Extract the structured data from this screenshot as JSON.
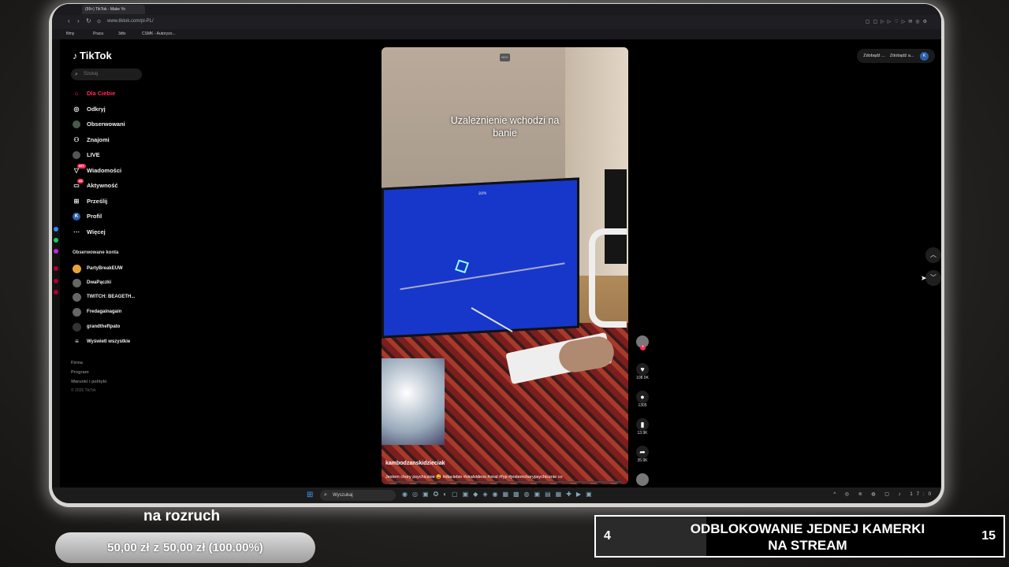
{
  "browser": {
    "tab_title": "(99+) TikTok - Make Yo",
    "url": "www.tiktok.com/pl-PL/",
    "bookmarks": [
      "filmy",
      "Praca",
      "3dtv",
      "CSMK - Autoryzo..."
    ]
  },
  "tiktok": {
    "logo": "TikTok",
    "search_placeholder": "Szukaj",
    "menu": [
      {
        "label": "Dla Ciebie",
        "icon": "home-icon",
        "active": true
      },
      {
        "label": "Odkryj",
        "icon": "compass-icon"
      },
      {
        "label": "Obserwowani",
        "icon": "following-icon"
      },
      {
        "label": "Znajomi",
        "icon": "friends-icon"
      },
      {
        "label": "LIVE",
        "icon": "live-icon"
      },
      {
        "label": "Wiadomości",
        "icon": "messages-icon",
        "badge": "99+"
      },
      {
        "label": "Aktywność",
        "icon": "activity-icon",
        "badge": "43"
      },
      {
        "label": "Prześlij",
        "icon": "upload-icon"
      },
      {
        "label": "Profil",
        "icon": "profile-icon",
        "avatar_letter": "K"
      },
      {
        "label": "Więcej",
        "icon": "more-icon"
      }
    ],
    "followed_title": "Obserwowane konta",
    "followed_accounts": [
      "PartyBreakEUW",
      "DwaPączki",
      "TWITCH: BEAGETH...",
      "Fredagainagain",
      "grandtheftpato",
      "Wyświetl wszystkie"
    ],
    "footer_links": [
      "Firma",
      "Program",
      "Warunki i polityki"
    ],
    "copyright": "© 2026 TikTok",
    "top_right": {
      "item1": "Zdobądź ...",
      "item2": "Zdobądź a...",
      "avatar": "K"
    }
  },
  "video": {
    "top_chip": "BGX",
    "caption_line1": "Uzależnienie wchodzi na",
    "caption_line2": "banie",
    "tv_text": "31%",
    "username": "kambodzanskidzieciak",
    "description": "Jestem chory psychicznie 😩 #dlaciebie #viralvideos #viral #fyp #jestemchorypsychicznie co",
    "likes": "108.9K",
    "comments": "1305",
    "saves": "13.9K",
    "shares": "35.9K"
  },
  "taskbar": {
    "search_placeholder": "Wyszukaj",
    "time": "17:0"
  },
  "overlays": {
    "goal_label": "na rozruch",
    "goal_amount": "50,00 zł",
    "goal_of": "z",
    "goal_target": "50,00 zł",
    "goal_percent": "(100.00%)",
    "goal_progress": 1.0,
    "banner_left": "4",
    "banner_text_line1": "ODBLOKOWANIE JEDNEJ KAMERKI",
    "banner_text_line2": "NA STREAM",
    "banner_right": "15",
    "banner_progress": 0.27
  }
}
